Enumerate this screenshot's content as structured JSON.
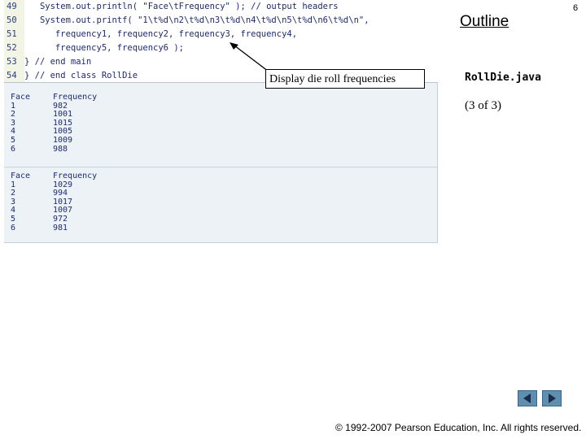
{
  "slide": {
    "page_number": "6",
    "outline_label": "Outline",
    "file_name": "RollDie.java",
    "position": "(3 of 3)"
  },
  "code": {
    "lines": [
      {
        "num": "49",
        "text": "   System.out.println( \"Face\\tFrequency\" ); // output headers"
      },
      {
        "num": "50",
        "text": "   System.out.printf( \"1\\t%d\\n2\\t%d\\n3\\t%d\\n4\\t%d\\n5\\t%d\\n6\\t%d\\n\","
      },
      {
        "num": "51",
        "text": "      frequency1, frequency2, frequency3, frequency4,"
      },
      {
        "num": "52",
        "text": "      frequency5, frequency6 );"
      },
      {
        "num": "53",
        "text": "} // end main"
      },
      {
        "num": "54",
        "text": "} // end class RollDie"
      }
    ]
  },
  "callout": {
    "text": "Display die roll frequencies"
  },
  "output": {
    "runs": [
      {
        "header_face": "Face",
        "header_freq": "Frequency",
        "rows": [
          {
            "face": "1",
            "freq": "982"
          },
          {
            "face": "2",
            "freq": "1001"
          },
          {
            "face": "3",
            "freq": "1015"
          },
          {
            "face": "4",
            "freq": "1005"
          },
          {
            "face": "5",
            "freq": "1009"
          },
          {
            "face": "6",
            "freq": "988"
          }
        ]
      },
      {
        "header_face": "Face",
        "header_freq": "Frequency",
        "rows": [
          {
            "face": "1",
            "freq": "1029"
          },
          {
            "face": "2",
            "freq": "994"
          },
          {
            "face": "3",
            "freq": "1017"
          },
          {
            "face": "4",
            "freq": "1007"
          },
          {
            "face": "5",
            "freq": "972"
          },
          {
            "face": "6",
            "freq": "981"
          }
        ]
      }
    ]
  },
  "navigation": {
    "prev_icon": "triangle-left-icon",
    "next_icon": "triangle-right-icon"
  },
  "footer": {
    "copyright": "© 1992-2007 Pearson Education, Inc.  All rights reserved."
  },
  "colors": {
    "output_background": "#ecf2f6",
    "code_text": "#1f2a6f",
    "nav_button": "#5f8fae"
  }
}
